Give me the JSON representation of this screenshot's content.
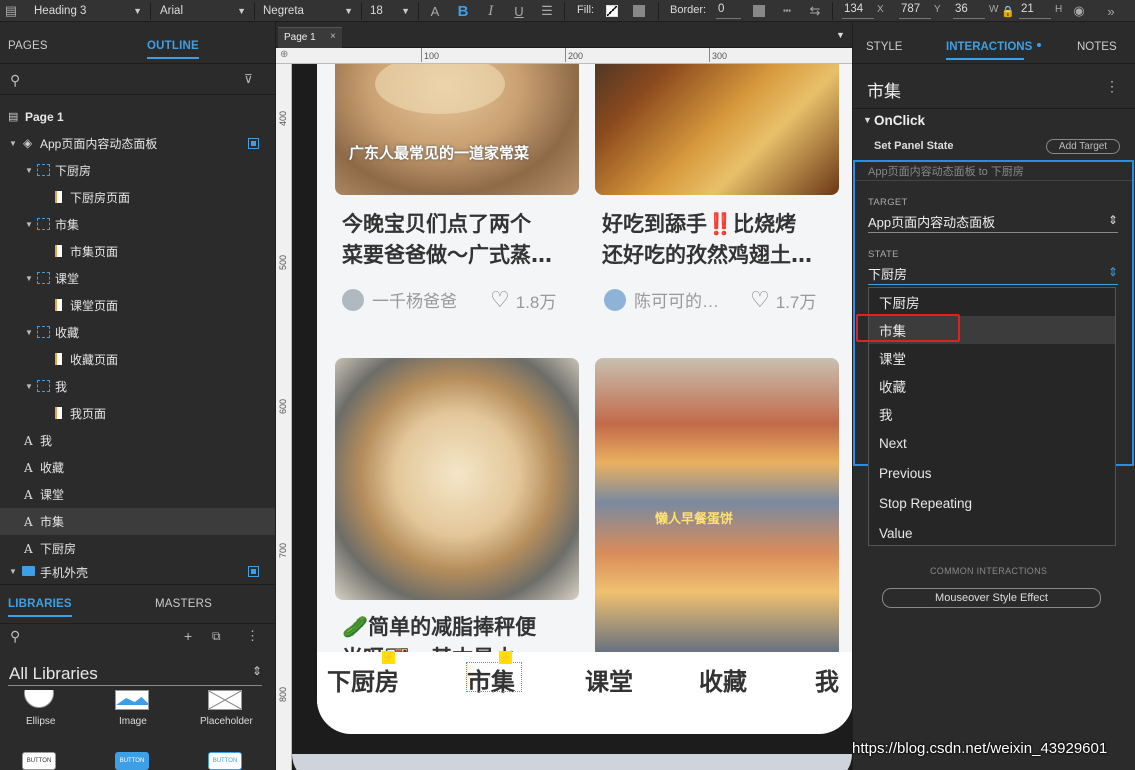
{
  "toolbar": {
    "style_select": "Heading 3",
    "font_select": "Arial",
    "weight_select": "Negreta",
    "size_select": "18",
    "fill_label": "Fill:",
    "border_label": "Border:",
    "border_value": "0",
    "x_value": "134",
    "x_label": "X",
    "y_value": "787",
    "y_label": "Y",
    "w_value": "36",
    "w_label": "W",
    "h_value": "21",
    "h_label": "H"
  },
  "left_panel": {
    "tabs": [
      "PAGES",
      "OUTLINE"
    ],
    "active_tab": "OUTLINE",
    "tree": [
      {
        "label": "Page 1",
        "kind": "page"
      },
      {
        "label": "App页面内容动态面板",
        "kind": "dynamic-panel"
      },
      {
        "label": "下厨房",
        "kind": "state"
      },
      {
        "label": "下厨房页面",
        "kind": "state-page"
      },
      {
        "label": "市集",
        "kind": "state"
      },
      {
        "label": "市集页面",
        "kind": "state-page"
      },
      {
        "label": "课堂",
        "kind": "state"
      },
      {
        "label": "课堂页面",
        "kind": "state-page"
      },
      {
        "label": "收藏",
        "kind": "state"
      },
      {
        "label": "收藏页面",
        "kind": "state-page"
      },
      {
        "label": "我",
        "kind": "state"
      },
      {
        "label": "我页面",
        "kind": "state-page"
      },
      {
        "label": "我",
        "kind": "text"
      },
      {
        "label": "收藏",
        "kind": "text"
      },
      {
        "label": "课堂",
        "kind": "text"
      },
      {
        "label": "市集",
        "kind": "text"
      },
      {
        "label": "下厨房",
        "kind": "text"
      },
      {
        "label": "手机外壳",
        "kind": "folder"
      }
    ],
    "lib_tabs": [
      "LIBRARIES",
      "MASTERS"
    ],
    "lib_select": "All Libraries",
    "widgets": [
      "Ellipse",
      "Image",
      "Placeholder"
    ],
    "button_label": "BUTTON"
  },
  "canvas": {
    "tab_label": "Page 1",
    "ruler_h": [
      "100",
      "200",
      "300"
    ],
    "ruler_v": [
      "400",
      "500",
      "600",
      "700",
      "800"
    ],
    "cards": [
      {
        "title_line1": "今晚宝贝们点了两个",
        "title_line2": "菜要爸爸做～广式蒸…",
        "author": "一千杨爸爸",
        "likes": "1.8万",
        "img_caption": "广东人最常见的一道家常菜"
      },
      {
        "title_line1": "好吃到舔手‼️比烧烤",
        "title_line2": "还好吃的孜然鸡翅土…",
        "author": "陈可可的…",
        "likes": "1.7万"
      },
      {
        "title_line1": "🥒简单的减脂捧秤便",
        "title_line2": "当呀🍱，基本是水…"
      },
      {
        "img_caption": "懒人早餐蛋饼"
      }
    ],
    "bottom_tabs": [
      "下厨房",
      "市集",
      "课堂",
      "收藏",
      "我"
    ]
  },
  "right_panel": {
    "tabs": [
      "STYLE",
      "INTERACTIONS",
      "NOTES"
    ],
    "active_tab": "INTERACTIONS",
    "widget_name": "市集",
    "event": "OnClick",
    "action": "Set Panel State",
    "add_target": "Add Target",
    "summary": "App页面内容动态面板 to 下厨房",
    "target_label": "TARGET",
    "target_value": "App页面内容动态面板",
    "state_label": "STATE",
    "state_value": "下厨房",
    "dropdown_options": [
      "下厨房",
      "市集",
      "课堂",
      "收藏",
      "我",
      "Next",
      "Previous",
      "Stop Repeating",
      "Value"
    ],
    "highlighted_option": "市集",
    "common_label": "COMMON INTERACTIONS",
    "mouseover_button": "Mouseover Style Effect"
  },
  "watermark": "https://blog.csdn.net/weixin_43929601",
  "colors": {
    "accent": "#3da0e6",
    "highlight_red": "#e0211d",
    "panel_bg": "#2b2b2b"
  }
}
